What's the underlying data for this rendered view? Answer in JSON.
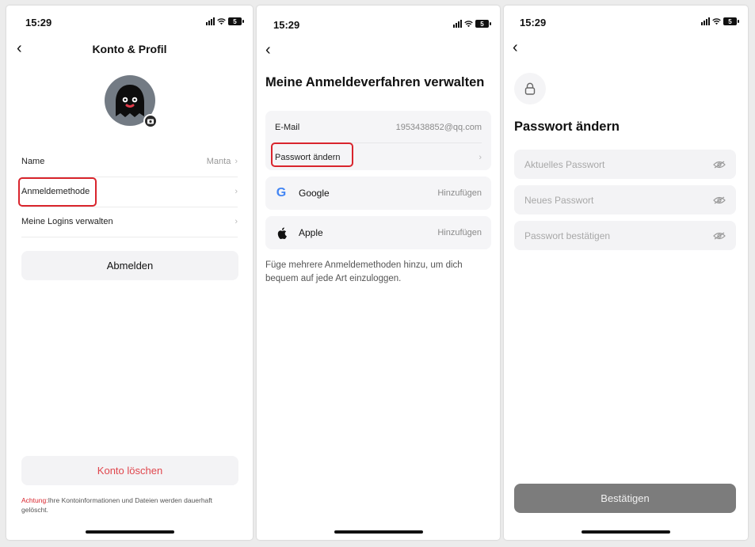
{
  "panel1": {
    "status_time": "15:29",
    "battery": "5",
    "title": "Konto & Profil",
    "rows": [
      {
        "label": "Name",
        "value": "Manta"
      },
      {
        "label": "Anmeldemethode"
      },
      {
        "label": "Meine Logins verwalten"
      }
    ],
    "logout_label": "Abmelden",
    "delete_label": "Konto löschen",
    "warning_label": "Achtung:",
    "warning_text": "Ihre Kontoinformationen und Dateien werden dauerhaft gelöscht."
  },
  "panel2": {
    "status_time": "15:29",
    "battery": "5",
    "title": "Meine Anmeldeverfahren verwalten",
    "email_label": "E-Mail",
    "email_value": "1953438852@qq.com",
    "change_password_label": "Passwort ändern",
    "providers": [
      {
        "name": "Google",
        "action": "Hinzufügen",
        "icon": "google-icon"
      },
      {
        "name": "Apple",
        "action": "Hinzufügen",
        "icon": "apple-icon"
      }
    ],
    "note": "Füge mehrere Anmeldemethoden hinzu, um dich bequem auf jede Art einzuloggen."
  },
  "panel3": {
    "status_time": "15:29",
    "battery": "5",
    "title": "Passwort ändern",
    "fields": [
      {
        "placeholder": "Aktuelles Passwort"
      },
      {
        "placeholder": "Neues Passwort"
      },
      {
        "placeholder": "Passwort bestätigen"
      }
    ],
    "confirm_label": "Bestätigen"
  },
  "colors": {
    "highlight": "#d9252d",
    "danger_text": "#e0464d",
    "confirm_button": "#7c7c7c",
    "avatar_bg": "#737b84"
  }
}
